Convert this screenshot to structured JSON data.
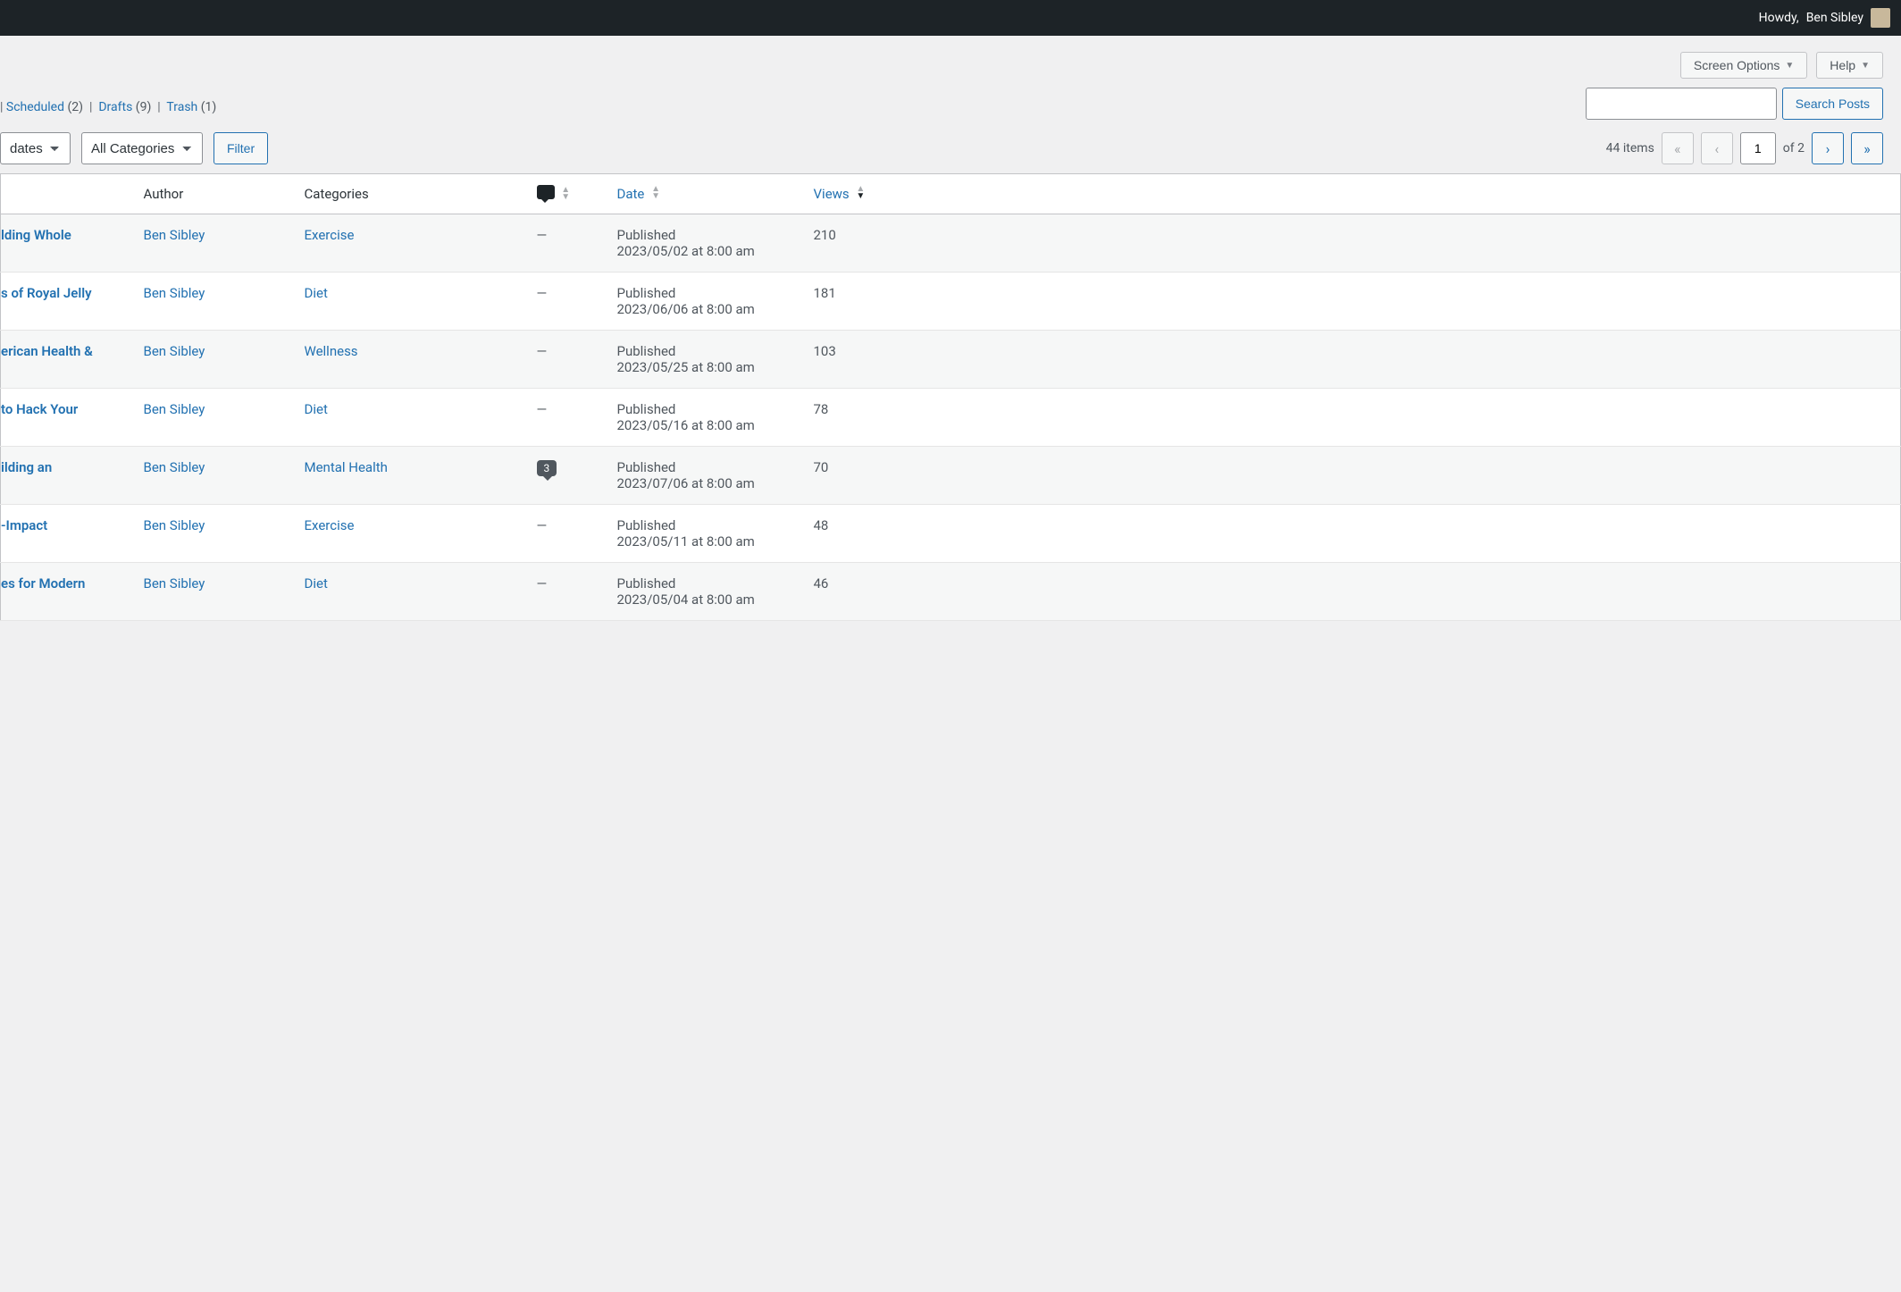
{
  "admin_bar": {
    "howdy_prefix": "Howdy,",
    "user_name": "Ben Sibley"
  },
  "top_buttons": {
    "screen_options": "Screen Options",
    "help": "Help"
  },
  "status_links": {
    "scheduled_label": "Scheduled",
    "scheduled_count": "(2)",
    "drafts_label": "Drafts",
    "drafts_count": "(9)",
    "trash_label": "Trash",
    "trash_count": "(1)"
  },
  "search": {
    "button": "Search Posts"
  },
  "filters": {
    "dates_option": "dates",
    "categories_option": "All Categories",
    "filter_button": "Filter"
  },
  "pagination": {
    "items_text": "44 items",
    "current_page": "1",
    "of_text": "of 2"
  },
  "columns": {
    "author": "Author",
    "categories": "Categories",
    "date": "Date",
    "views": "Views"
  },
  "rows": [
    {
      "title": "lding Whole",
      "author": "Ben Sibley",
      "category": "Exercise",
      "comments": "—",
      "status": "Published",
      "datetime": "2023/05/02 at 8:00 am",
      "views": "210"
    },
    {
      "title": "s of Royal Jelly",
      "author": "Ben Sibley",
      "category": "Diet",
      "comments": "—",
      "status": "Published",
      "datetime": "2023/06/06 at 8:00 am",
      "views": "181"
    },
    {
      "title": "erican Health &",
      "author": "Ben Sibley",
      "category": "Wellness",
      "comments": "—",
      "status": "Published",
      "datetime": "2023/05/25 at 8:00 am",
      "views": "103"
    },
    {
      "title": "to Hack Your",
      "author": "Ben Sibley",
      "category": "Diet",
      "comments": "—",
      "status": "Published",
      "datetime": "2023/05/16 at 8:00 am",
      "views": "78"
    },
    {
      "title": "ilding an",
      "author": "Ben Sibley",
      "category": "Mental Health",
      "comments": "3",
      "status": "Published",
      "datetime": "2023/07/06 at 8:00 am",
      "views": "70"
    },
    {
      "title": "-Impact",
      "author": "Ben Sibley",
      "category": "Exercise",
      "comments": "—",
      "status": "Published",
      "datetime": "2023/05/11 at 8:00 am",
      "views": "48"
    },
    {
      "title": "es for Modern",
      "author": "Ben Sibley",
      "category": "Diet",
      "comments": "—",
      "status": "Published",
      "datetime": "2023/05/04 at 8:00 am",
      "views": "46"
    }
  ]
}
